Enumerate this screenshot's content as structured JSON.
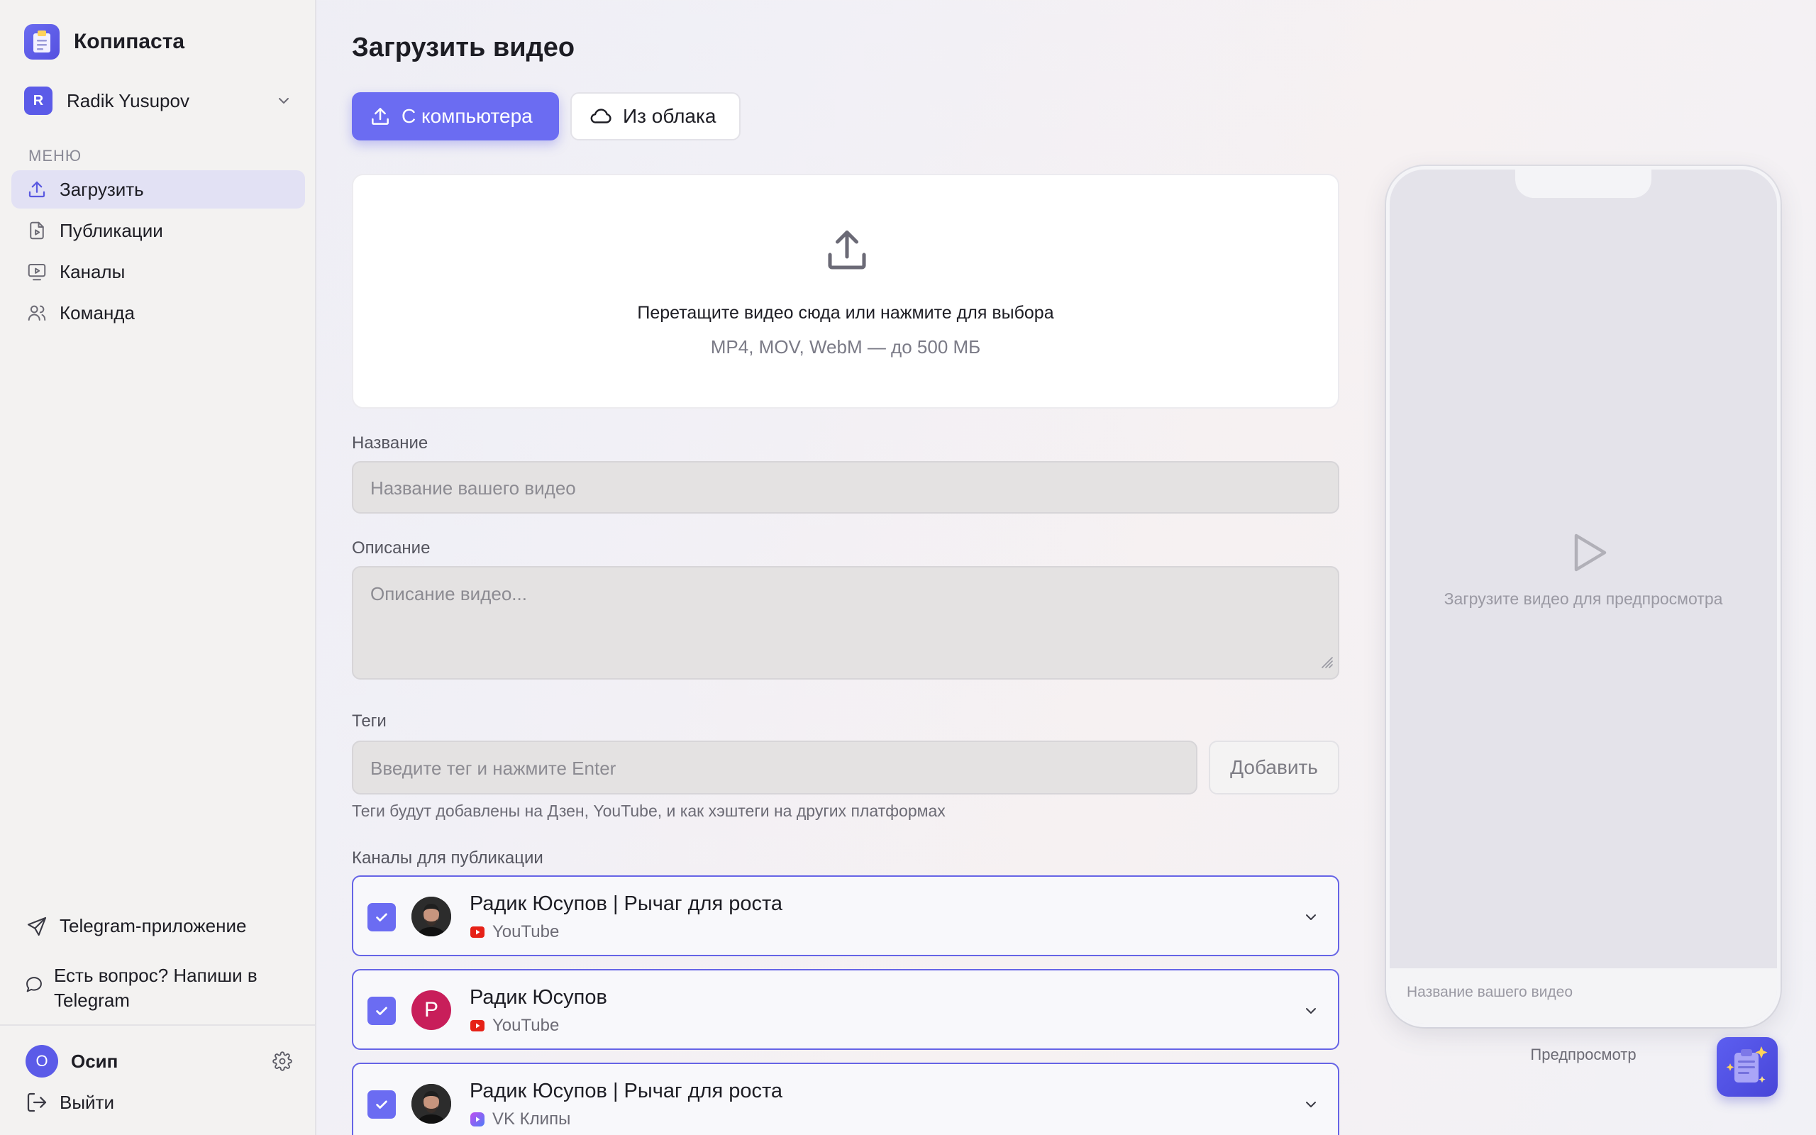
{
  "brand": {
    "name": "Копипаста"
  },
  "account": {
    "initial": "R",
    "name": "Radik Yusupov"
  },
  "sidebar": {
    "menu_caption": "МЕНЮ",
    "items": [
      {
        "label": "Загрузить",
        "icon": "upload-icon",
        "active": true
      },
      {
        "label": "Публикации",
        "icon": "document-video-icon",
        "active": false
      },
      {
        "label": "Каналы",
        "icon": "tv-play-icon",
        "active": false
      },
      {
        "label": "Команда",
        "icon": "users-icon",
        "active": false
      }
    ],
    "telegram_app": "Telegram-приложение",
    "question_line1": "Есть вопрос? Напиши в",
    "question_line2": "Telegram",
    "user": {
      "initial": "О",
      "name": "Осип"
    },
    "logout": "Выйти"
  },
  "main": {
    "title": "Загрузить видео",
    "tabs": [
      {
        "label": "С компьютера",
        "icon": "upload-icon",
        "active": true
      },
      {
        "label": "Из облака",
        "icon": "cloud-icon",
        "active": false
      }
    ],
    "dropzone": {
      "text": "Перетащите видео сюда или нажмите для выбора",
      "formats": "MP4, MOV, WebM — до 500 МБ"
    },
    "form": {
      "title_label": "Название",
      "title_placeholder": "Название вашего видео",
      "description_label": "Описание",
      "description_placeholder": "Описание видео...",
      "tags_label": "Теги",
      "tags_placeholder": "Введите тег и нажмите Enter",
      "add_button": "Добавить",
      "tags_hint": "Теги будут добавлены на Дзен, YouTube, и как хэштеги на других платформах",
      "channels_label": "Каналы для публикации"
    },
    "channels": [
      {
        "name": "Радик Юсупов | Рычаг для роста",
        "platform": "YouTube",
        "checked": true
      },
      {
        "name": "Радик Юсупов",
        "platform": "YouTube",
        "checked": true,
        "avatar_letter": "Р"
      },
      {
        "name": "Радик Юсупов | Рычаг для роста",
        "platform": "VK Клипы",
        "checked": true
      }
    ]
  },
  "preview": {
    "hint": "Загрузите видео для предпросмотра",
    "title_placeholder": "Название вашего видео",
    "label": "Предпросмотр"
  },
  "colors": {
    "accent": "#6b6cf2",
    "youtube": "#e62117",
    "vk_clips": "#8a5cf6"
  }
}
